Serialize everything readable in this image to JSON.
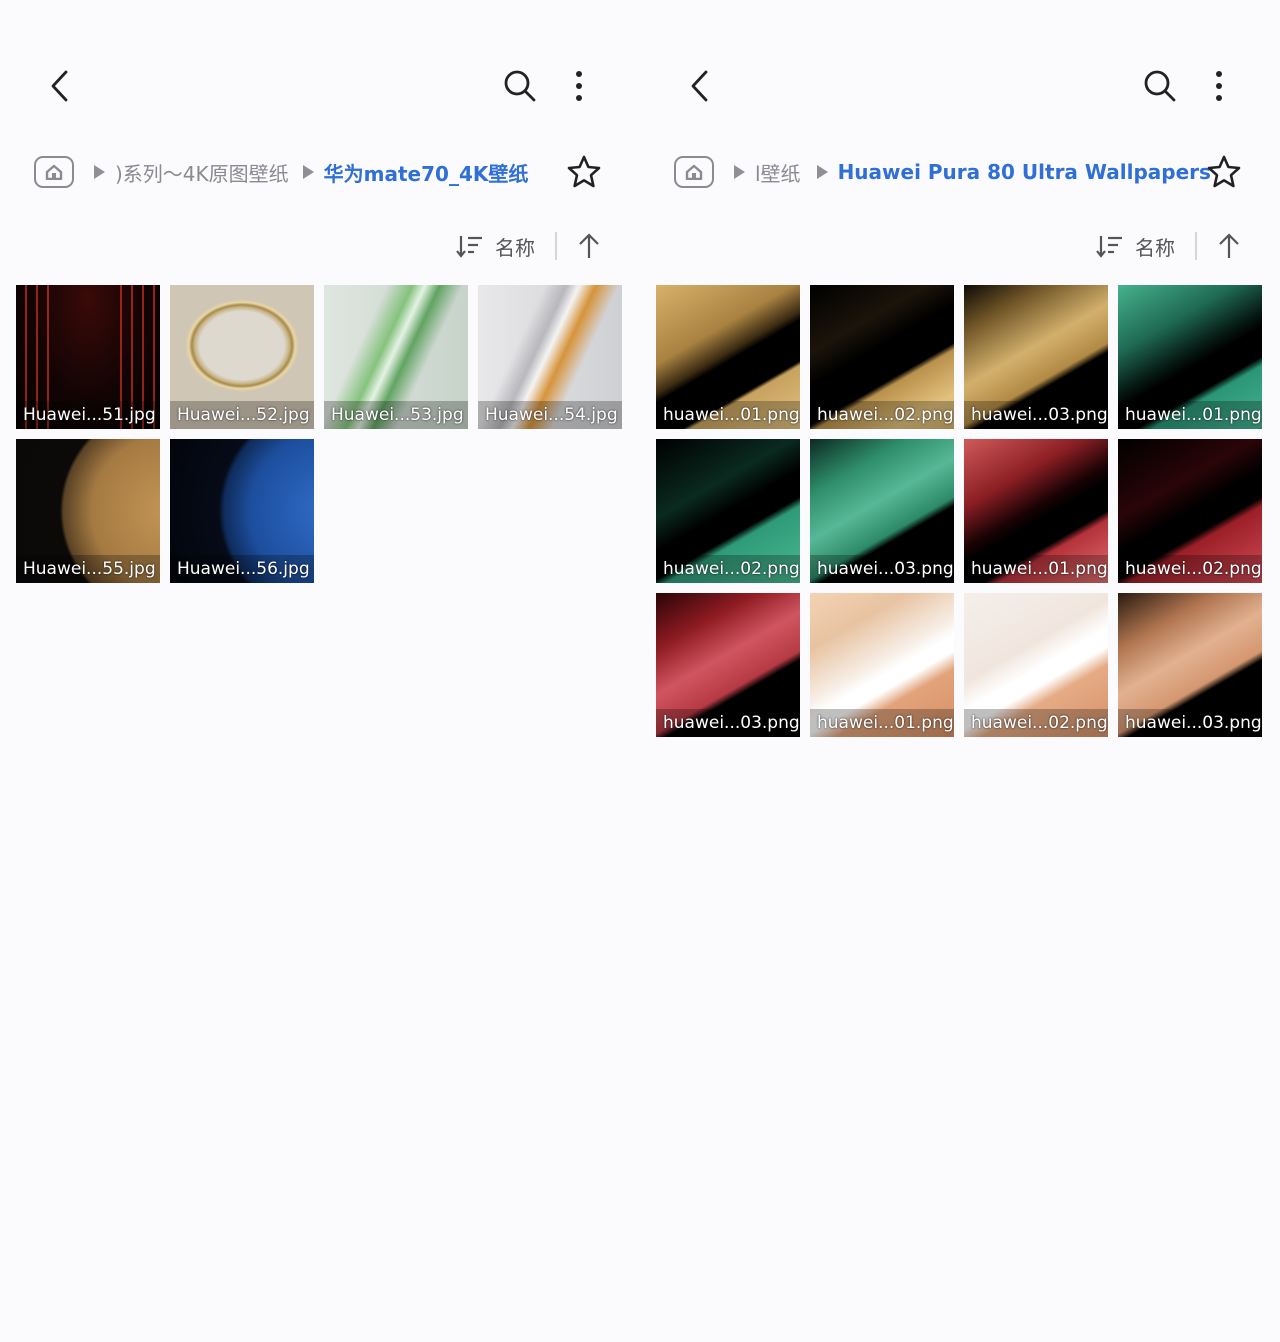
{
  "left": {
    "breadcrumb": {
      "parent": ")系列～4K原图壁纸",
      "current": "华为mate70_4K壁纸"
    },
    "sort": {
      "label": "名称"
    },
    "files": [
      {
        "name": "Huawei...51.jpg",
        "thumb": "red-curtain"
      },
      {
        "name": "Huawei...52.jpg",
        "thumb": "gold-ring"
      },
      {
        "name": "Huawei...53.jpg",
        "thumb": "green-wave"
      },
      {
        "name": "Huawei...54.jpg",
        "thumb": "amber-wave"
      },
      {
        "name": "Huawei...55.jpg",
        "thumb": "golden-moon"
      },
      {
        "name": "Huawei...56.jpg",
        "thumb": "blue-earth"
      }
    ]
  },
  "right": {
    "breadcrumb": {
      "parent": "l壁纸",
      "current": "Huawei Pura 80 Ultra Wallpapers"
    },
    "sort": {
      "label": "名称"
    },
    "files": [
      {
        "name": "huawei...01.png",
        "thumb": "gold"
      },
      {
        "name": "huawei...02.png",
        "thumb": "gold"
      },
      {
        "name": "huawei...03.png",
        "thumb": "gold"
      },
      {
        "name": "huawei...01.png",
        "thumb": "green"
      },
      {
        "name": "huawei...02.png",
        "thumb": "green"
      },
      {
        "name": "huawei...03.png",
        "thumb": "green"
      },
      {
        "name": "huawei...01.png",
        "thumb": "red"
      },
      {
        "name": "huawei...02.png",
        "thumb": "red"
      },
      {
        "name": "huawei...03.png",
        "thumb": "red"
      },
      {
        "name": "huawei...01.png",
        "thumb": "peach"
      },
      {
        "name": "huawei...02.png",
        "thumb": "peach"
      },
      {
        "name": "huawei...03.png",
        "thumb": "peach"
      }
    ]
  },
  "colors": {
    "accent": "#2f6fd6",
    "muted_text": "#8a8a90",
    "background": "#fbfbfd"
  }
}
